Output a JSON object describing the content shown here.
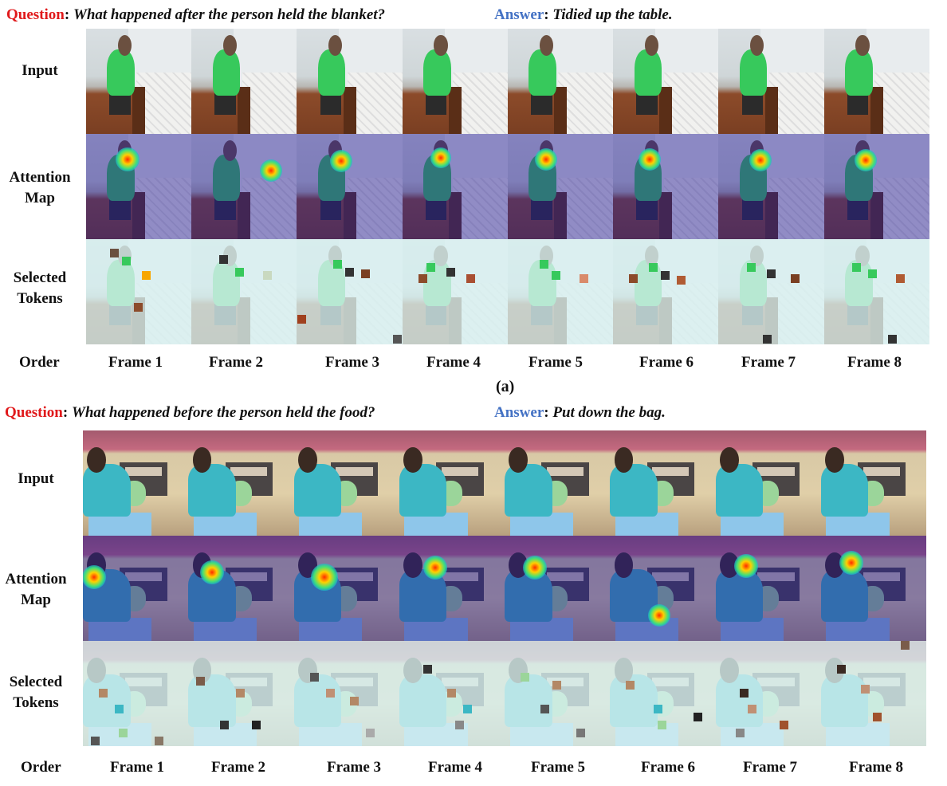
{
  "figure_a": {
    "question_key": "Question",
    "question_text": "What happened after the person held the blanket?",
    "answer_key": "Answer",
    "answer_text": "Tidied up the table.",
    "row_labels": {
      "input": "Input",
      "attention_line1": "Attention",
      "attention_line2": "Map",
      "selected_line1": "Selected",
      "selected_line2": "Tokens"
    },
    "order_label": "Order",
    "frames": [
      "Frame 1",
      "Frame 2",
      "Frame 3",
      "Frame 4",
      "Frame 5",
      "Frame 6",
      "Frame 7",
      "Frame 8"
    ],
    "caption": "(a)"
  },
  "figure_b": {
    "question_key": "Question",
    "question_text": "What happened before the person held the food?",
    "answer_key": "Answer",
    "answer_text": "Put down the bag.",
    "row_labels": {
      "input": "Input",
      "attention_line1": "Attention",
      "attention_line2": "Map",
      "selected_line1": "Selected",
      "selected_line2": "Tokens"
    },
    "order_label": "Order",
    "frames": [
      "Frame 1",
      "Frame 2",
      "Frame 3",
      "Frame 4",
      "Frame 5",
      "Frame 6",
      "Frame 7",
      "Frame 8"
    ]
  },
  "colors": {
    "question": "#e0191b",
    "answer": "#4472c4"
  }
}
